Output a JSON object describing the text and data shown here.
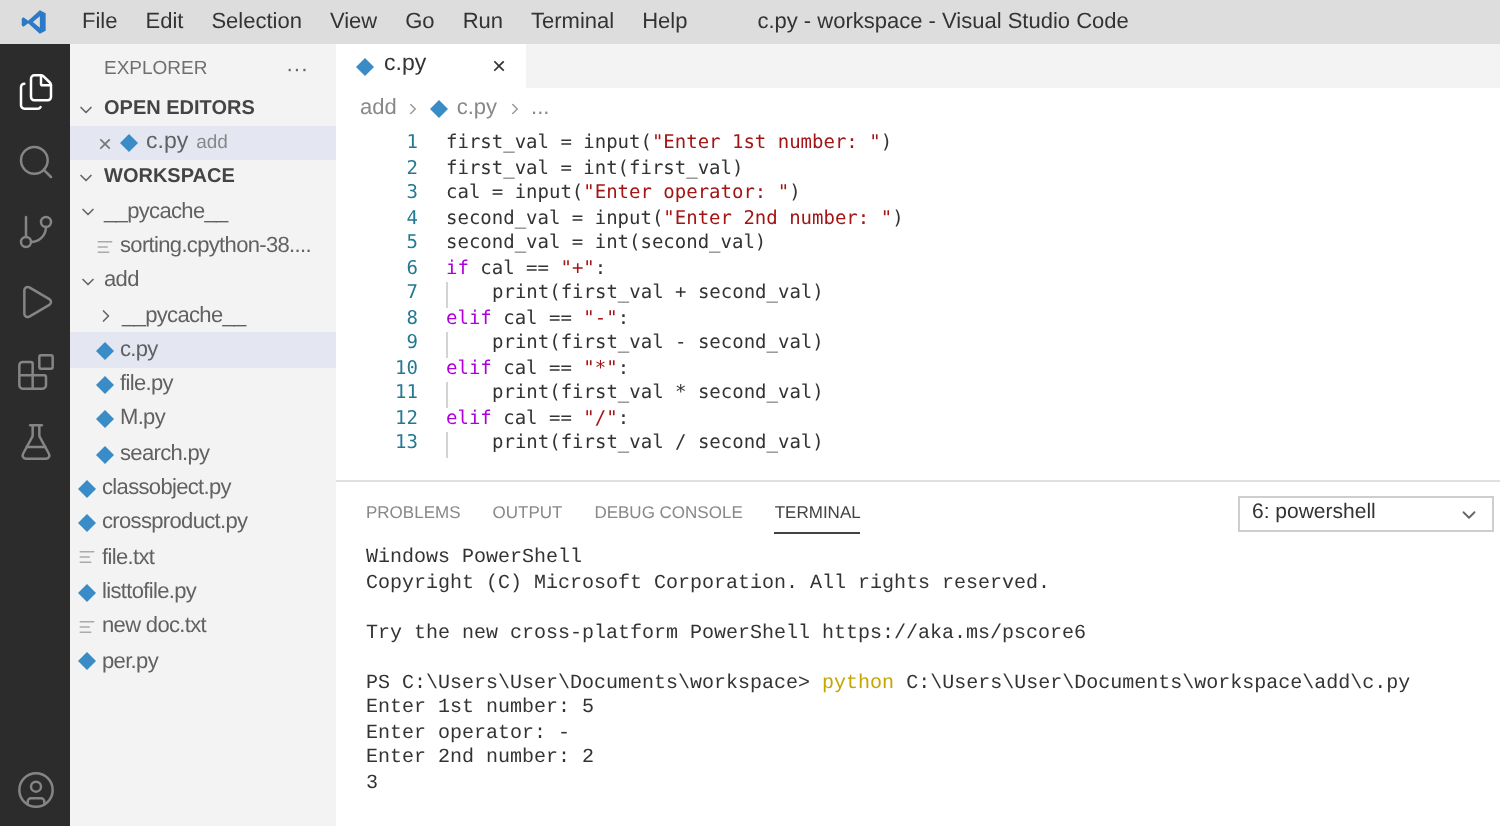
{
  "window": {
    "title": "c.py - workspace - Visual Studio Code"
  },
  "menu": [
    "File",
    "Edit",
    "Selection",
    "View",
    "Go",
    "Run",
    "Terminal",
    "Help"
  ],
  "activity_bar": [
    {
      "kind": "files",
      "selected": true
    },
    {
      "kind": "search",
      "selected": false
    },
    {
      "kind": "source-control",
      "selected": false
    },
    {
      "kind": "run",
      "selected": false
    },
    {
      "kind": "extensions",
      "selected": false
    },
    {
      "kind": "testing",
      "selected": false
    }
  ],
  "sidebar": {
    "title": "EXPLORER",
    "more": "···",
    "open_editors": {
      "label": "OPEN EDITORS",
      "expanded": true,
      "items": [
        {
          "name": "c.py",
          "folder": "add",
          "close": "×"
        }
      ]
    },
    "workspace": {
      "label": "WORKSPACE",
      "expanded": true,
      "items": [
        {
          "name": "__pycache__",
          "kind": "folder",
          "expanded": true,
          "selected": false,
          "children": [
            {
              "name": "sorting.cpython-38....",
              "kind": "txt",
              "selected": false
            }
          ]
        },
        {
          "name": "add",
          "kind": "folder",
          "expanded": true,
          "selected": false,
          "children": [
            {
              "name": "__pycache__",
              "kind": "folder",
              "expanded": false,
              "selected": false
            },
            {
              "name": "c.py",
              "kind": "py",
              "selected": true
            },
            {
              "name": "file.py",
              "kind": "py",
              "selected": false
            },
            {
              "name": "M.py",
              "kind": "py",
              "selected": false
            },
            {
              "name": "search.py",
              "kind": "py",
              "selected": false
            }
          ]
        },
        {
          "name": "classobject.py",
          "kind": "py",
          "selected": false
        },
        {
          "name": "crossproduct.py",
          "kind": "py",
          "selected": false
        },
        {
          "name": "file.txt",
          "kind": "txt",
          "selected": false
        },
        {
          "name": "listtofile.py",
          "kind": "py",
          "selected": false
        },
        {
          "name": "new doc.txt",
          "kind": "txt",
          "selected": false
        },
        {
          "name": "per.py",
          "kind": "py",
          "selected": false
        }
      ]
    }
  },
  "editor": {
    "tabs": [
      {
        "name": "c.py",
        "close": "×",
        "selected": true
      }
    ],
    "breadcrumb": [
      "add",
      "c.py",
      "..."
    ],
    "lines": [
      {
        "number": "1",
        "indented": false,
        "tokens": [
          {
            "text": "first_val = input(",
            "kind": "plain"
          },
          {
            "text": "\"Enter 1st number: \"",
            "kind": "string"
          },
          {
            "text": ")",
            "kind": "plain"
          }
        ]
      },
      {
        "number": "2",
        "indented": false,
        "tokens": [
          {
            "text": "first_val = int(first_val)",
            "kind": "plain"
          }
        ]
      },
      {
        "number": "3",
        "indented": false,
        "tokens": [
          {
            "text": "cal = input(",
            "kind": "plain"
          },
          {
            "text": "\"Enter operator: \"",
            "kind": "string"
          },
          {
            "text": ")",
            "kind": "plain"
          }
        ]
      },
      {
        "number": "4",
        "indented": false,
        "tokens": [
          {
            "text": "second_val = input(",
            "kind": "plain"
          },
          {
            "text": "\"Enter 2nd number: \"",
            "kind": "string"
          },
          {
            "text": ")",
            "kind": "plain"
          }
        ]
      },
      {
        "number": "5",
        "indented": false,
        "tokens": [
          {
            "text": "second_val = int(second_val)",
            "kind": "plain"
          }
        ]
      },
      {
        "number": "6",
        "indented": false,
        "tokens": [
          {
            "text": "if",
            "kind": "keyword"
          },
          {
            "text": " cal == ",
            "kind": "plain"
          },
          {
            "text": "\"+\"",
            "kind": "string"
          },
          {
            "text": ":",
            "kind": "plain"
          }
        ]
      },
      {
        "number": "7",
        "indented": true,
        "tokens": [
          {
            "text": "print(first_val + second_val)",
            "kind": "plain"
          }
        ]
      },
      {
        "number": "8",
        "indented": false,
        "tokens": [
          {
            "text": "elif",
            "kind": "keyword"
          },
          {
            "text": " cal == ",
            "kind": "plain"
          },
          {
            "text": "\"-\"",
            "kind": "string"
          },
          {
            "text": ":",
            "kind": "plain"
          }
        ]
      },
      {
        "number": "9",
        "indented": true,
        "tokens": [
          {
            "text": "print(first_val - second_val)",
            "kind": "plain"
          }
        ]
      },
      {
        "number": "10",
        "indented": false,
        "tokens": [
          {
            "text": "elif",
            "kind": "keyword"
          },
          {
            "text": " cal == ",
            "kind": "plain"
          },
          {
            "text": "\"*\"",
            "kind": "string"
          },
          {
            "text": ":",
            "kind": "plain"
          }
        ]
      },
      {
        "number": "11",
        "indented": true,
        "tokens": [
          {
            "text": "print(first_val * second_val)",
            "kind": "plain"
          }
        ]
      },
      {
        "number": "12",
        "indented": false,
        "tokens": [
          {
            "text": "elif",
            "kind": "keyword"
          },
          {
            "text": " cal == ",
            "kind": "plain"
          },
          {
            "text": "\"/\"",
            "kind": "string"
          },
          {
            "text": ":",
            "kind": "plain"
          }
        ]
      },
      {
        "number": "13",
        "indented": true,
        "tokens": [
          {
            "text": "print(first_val / second_val)",
            "kind": "plain"
          }
        ]
      }
    ]
  },
  "panel": {
    "tabs": [
      {
        "label": "PROBLEMS",
        "selected": false
      },
      {
        "label": "OUTPUT",
        "selected": false
      },
      {
        "label": "DEBUG CONSOLE",
        "selected": false
      },
      {
        "label": "TERMINAL",
        "selected": true
      }
    ],
    "terminal_select": {
      "value": "6: powershell"
    },
    "terminal_blocks": [
      [
        [
          {
            "text": "Windows PowerShell",
            "kind": "plain"
          }
        ],
        [
          {
            "text": "Copyright (C) Microsoft Corporation. All rights reserved.",
            "kind": "plain"
          }
        ]
      ],
      [
        [
          {
            "text": "Try the new cross-platform PowerShell https://aka.ms/pscore6",
            "kind": "plain"
          }
        ]
      ],
      [
        [
          {
            "text": "PS C:\\Users\\User\\Documents\\workspace> ",
            "kind": "plain"
          },
          {
            "text": "python",
            "kind": "command"
          },
          {
            "text": " C:\\Users\\User\\Documents\\workspace\\add\\c.py",
            "kind": "plain"
          }
        ],
        [
          {
            "text": "Enter 1st number: 5",
            "kind": "plain"
          }
        ],
        [
          {
            "text": "Enter operator: -",
            "kind": "plain"
          }
        ],
        [
          {
            "text": "Enter 2nd number: 2",
            "kind": "plain"
          }
        ],
        [
          {
            "text": "3",
            "kind": "plain"
          }
        ]
      ]
    ]
  }
}
